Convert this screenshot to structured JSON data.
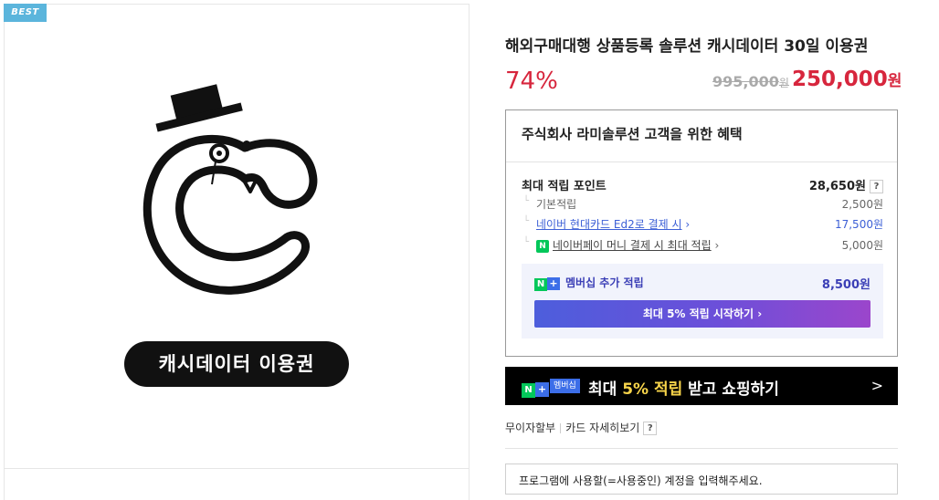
{
  "badge": {
    "label": "BEST"
  },
  "product_image": {
    "pill_text": "캐시데이터 이용권"
  },
  "product": {
    "title": "해외구매대행 상품등록 솔루션 캐시데이터 30일 이용권",
    "discount": "74%",
    "original_price": "995,000",
    "original_unit": "원",
    "sale_price": "250,000",
    "sale_unit": "원"
  },
  "benefits": {
    "title": "주식회사 라미솔루션 고객을 위한 혜택",
    "max_label": "최대 적립 포인트",
    "max_value": "28,650원",
    "help": "?",
    "basic_label": "기본적립",
    "basic_value": "2,500원",
    "card_label": "네이버 현대카드 Ed2로 결제 시",
    "card_value": "17,500원",
    "npay_label": "네이버페이 머니 결제 시 최대 적립",
    "npay_value": "5,000원",
    "membership_label": "멤버십 추가 적립",
    "membership_value": "8,500원",
    "start_button": "최대 5% 적립 시작하기"
  },
  "banner": {
    "badge_n": "N",
    "badge_plus": "+",
    "badge_member": "멤버십",
    "text_before": "최대 ",
    "text_highlight": "5% 적립",
    "text_after": " 받고 쇼핑하기",
    "chevron": ">"
  },
  "links": {
    "interest_free": "무이자할부",
    "card_detail": "카드 자세히보기",
    "help": "?"
  },
  "account_input": {
    "placeholder": "프로그램에 사용할(=사용중인) 계정을 입력해주세요."
  },
  "colors": {
    "accent_red": "#d7263d",
    "naver_green": "#03c75a",
    "badge_blue": "#5bb5dc"
  }
}
